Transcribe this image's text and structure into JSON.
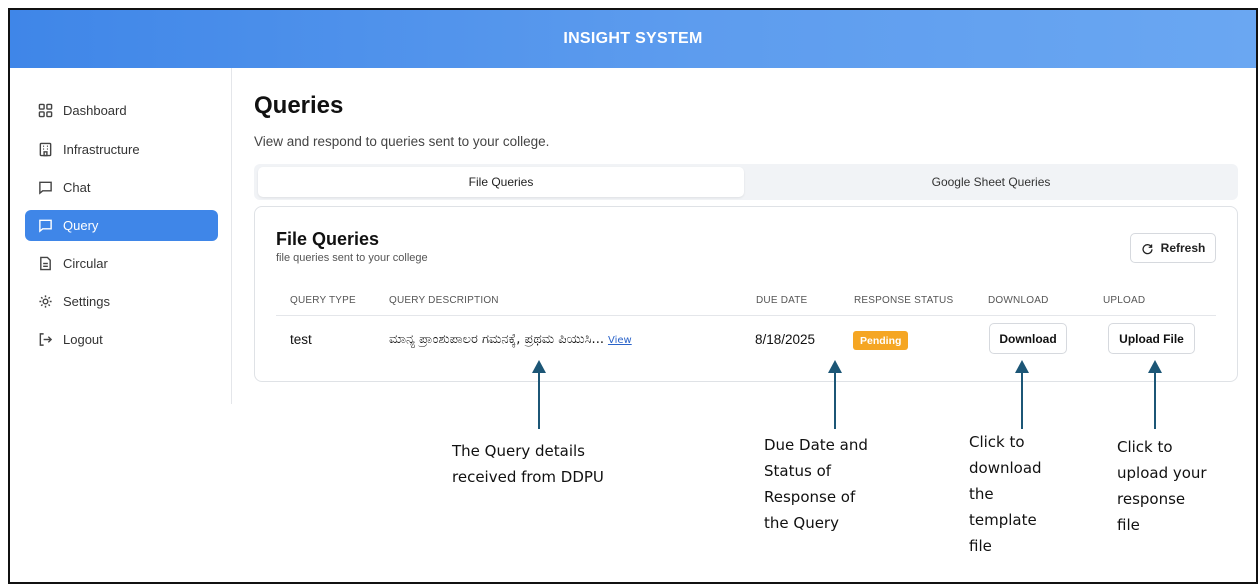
{
  "app": {
    "title": "INSIGHT SYSTEM"
  },
  "sidebar": {
    "items": [
      {
        "label": "Dashboard",
        "icon": "grid-icon"
      },
      {
        "label": "Infrastructure",
        "icon": "building-icon"
      },
      {
        "label": "Chat",
        "icon": "chat-icon"
      },
      {
        "label": "Query",
        "icon": "query-icon",
        "active": true
      },
      {
        "label": "Circular",
        "icon": "document-icon"
      },
      {
        "label": "Settings",
        "icon": "gear-icon"
      },
      {
        "label": "Logout",
        "icon": "logout-icon"
      }
    ]
  },
  "main": {
    "title": "Queries",
    "subtitle": "View and respond to queries sent to your college.",
    "tabs": [
      {
        "label": "File Queries",
        "active": true
      },
      {
        "label": "Google Sheet Queries"
      }
    ],
    "card": {
      "title": "File Queries",
      "subtitle": "file queries sent to your college",
      "refresh_label": "Refresh",
      "columns": [
        "QUERY TYPE",
        "QUERY DESCRIPTION",
        "DUE DATE",
        "RESPONSE STATUS",
        "DOWNLOAD",
        "UPLOAD"
      ],
      "rows": [
        {
          "query_type": "test",
          "description": "ಮಾನ್ಯ ಪ್ರಾಂಶುಪಾಲರ ಗಮನಕ್ಕೆ, ಪ್ರಥಮ ಪಿಯುಸಿ...",
          "view_label": "View",
          "due_date": "8/18/2025",
          "status": "Pending",
          "download_label": "Download",
          "upload_label": "Upload File"
        }
      ]
    }
  },
  "annotations": {
    "query_details": [
      "The Query details",
      "received from DDPU"
    ],
    "due_status": [
      "Due Date and",
      "Status of",
      "Response of",
      "the Query"
    ],
    "download": [
      "Click to",
      "download",
      "the",
      "template",
      "file"
    ],
    "upload": [
      "Click to",
      "upload your",
      "response",
      "file"
    ]
  },
  "colors": {
    "accent": "#3f86e8",
    "pending": "#f5a623",
    "arrow": "#1c5676",
    "link": "#2a63c9"
  }
}
